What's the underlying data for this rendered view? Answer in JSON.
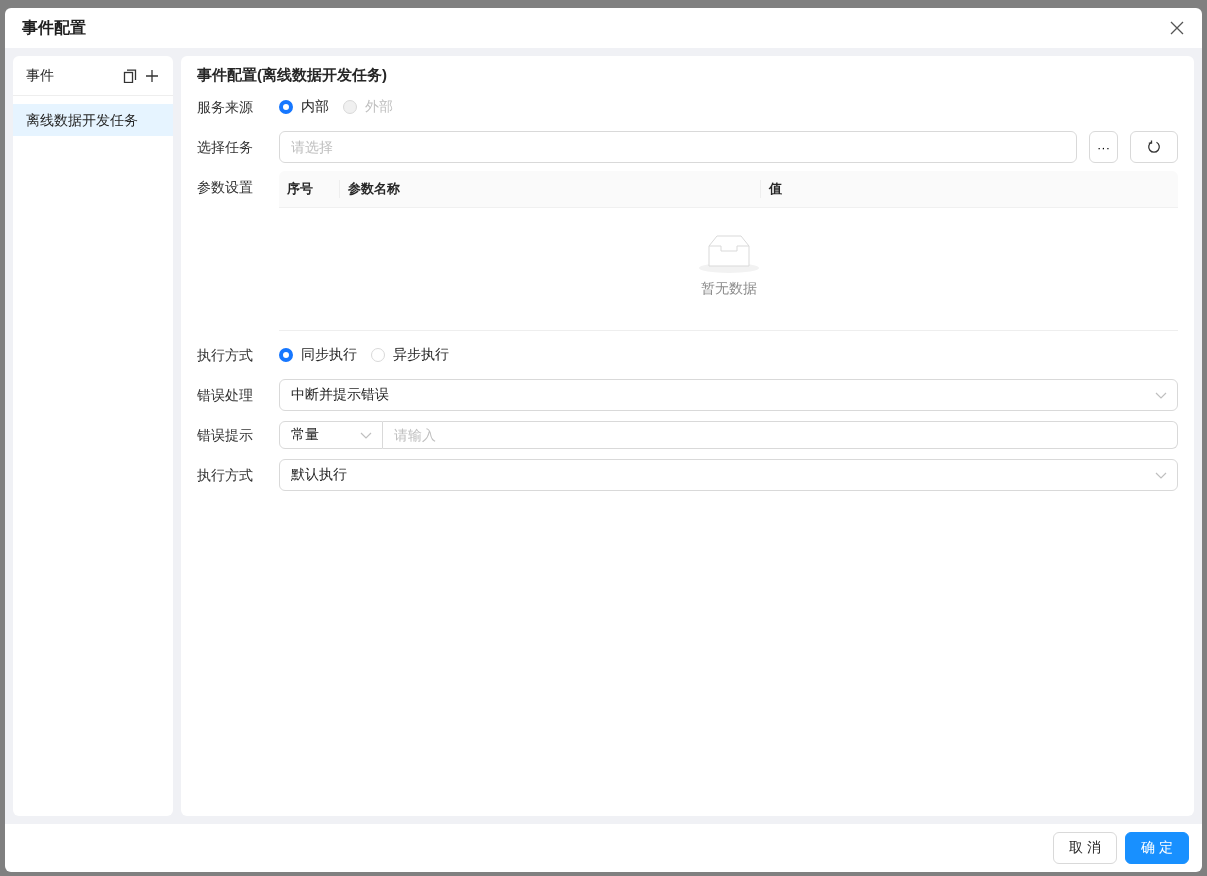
{
  "dialog": {
    "title": "事件配置"
  },
  "events_panel": {
    "title": "事件",
    "items": [
      {
        "label": "离线数据开发任务",
        "selected": true
      }
    ]
  },
  "config": {
    "title": "事件配置(离线数据开发任务)",
    "service_source": {
      "label": "服务来源",
      "options": [
        {
          "label": "内部",
          "selected": true,
          "disabled": false
        },
        {
          "label": "外部",
          "selected": false,
          "disabled": true
        }
      ]
    },
    "task": {
      "label": "选择任务",
      "placeholder": "请选择",
      "more_button": "···"
    },
    "params": {
      "label": "参数设置",
      "columns": [
        "序号",
        "参数名称",
        "值"
      ],
      "empty_text": "暂无数据"
    },
    "exec_mode": {
      "label": "执行方式",
      "options": [
        {
          "label": "同步执行",
          "selected": true,
          "disabled": false
        },
        {
          "label": "异步执行",
          "selected": false,
          "disabled": false
        }
      ]
    },
    "error_handling": {
      "label": "错误处理",
      "value": "中断并提示错误"
    },
    "error_hint": {
      "label": "错误提示",
      "type_value": "常量",
      "placeholder": "请输入"
    },
    "exec_style": {
      "label": "执行方式",
      "value": "默认执行"
    }
  },
  "footer": {
    "buttons": [
      {
        "label": "取 消",
        "kind": "default"
      },
      {
        "label": "确 定",
        "kind": "primary"
      }
    ]
  }
}
